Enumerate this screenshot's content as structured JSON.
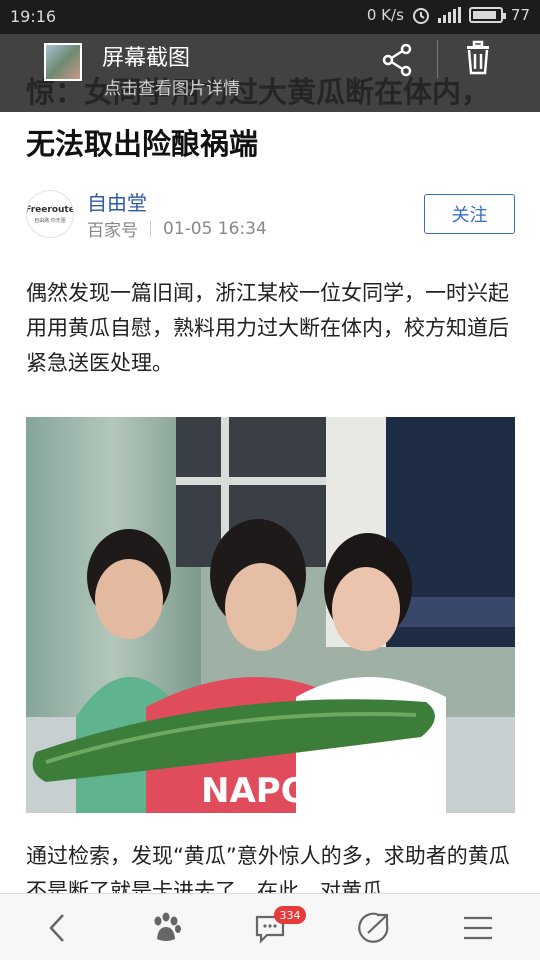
{
  "status_bar": {
    "time": "19:16",
    "net_speed": "0 K/s",
    "battery": "77",
    "battery_level": 0.77
  },
  "screenshot_notice": {
    "title": "屏幕截图",
    "subtitle": "点击查看图片详情",
    "share_icon": "share-icon",
    "delete_icon": "trash-icon"
  },
  "article": {
    "headline": "惊：女同学用力过大黄瓜断在体内，无法取出险酿祸端",
    "author": {
      "name": "自由堂",
      "source": "百家号",
      "time": "01-05 16:34",
      "avatar_text": "Freeroute",
      "avatar_sub": "自由路 你无阻",
      "follow_label": "关注"
    },
    "paragraph1": "偶然发现一篇旧闻，浙江某校一位女同学，一时兴起用用黄瓜自慰，熟料用力过大断在体内，校方知道后紧急送医处理。",
    "photo_text": "NAPOL",
    "paragraph2": "通过检索，发现“黄瓜”意外惊人的多，求助者的黄瓜不是断了就是卡进去了，在此，对黄瓜"
  },
  "bottom_nav": {
    "items": [
      "back-icon",
      "baidu-paw-icon",
      "comment-icon",
      "share-out-icon",
      "menu-icon"
    ],
    "comment_count": "334"
  }
}
